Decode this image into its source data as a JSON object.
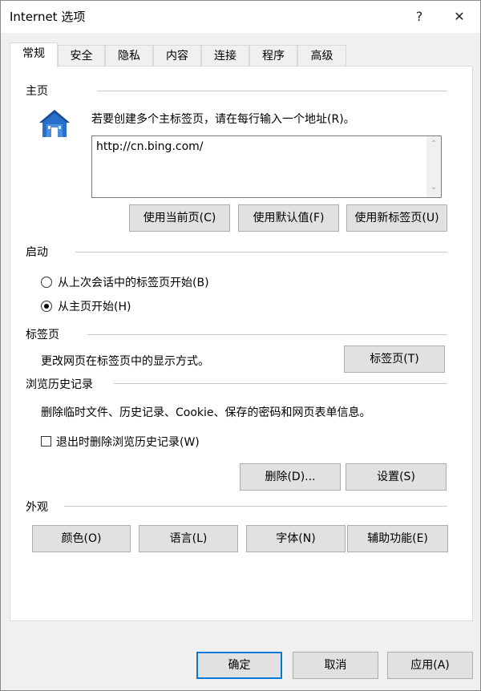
{
  "window": {
    "title": "Internet 选项",
    "help_label": "?",
    "close_label": "✕"
  },
  "tabs": [
    {
      "label": "常规",
      "active": true
    },
    {
      "label": "安全"
    },
    {
      "label": "隐私"
    },
    {
      "label": "内容"
    },
    {
      "label": "连接"
    },
    {
      "label": "程序"
    },
    {
      "label": "高级"
    }
  ],
  "homepage": {
    "group_label": "主页",
    "icon": "house-icon",
    "instruction": "若要创建多个主标签页，请在每行输入一个地址(R)。",
    "address_value": "http://cn.bing.com/",
    "use_current_label": "使用当前页(C)",
    "use_default_label": "使用默认值(F)",
    "use_new_tab_label": "使用新标签页(U)"
  },
  "startup": {
    "group_label": "启动",
    "option_last_session": "从上次会话中的标签页开始(B)",
    "option_home": "从主页开始(H)",
    "selected": "home"
  },
  "tabs_section": {
    "group_label": "标签页",
    "description": "更改网页在标签页中的显示方式。",
    "button_label": "标签页(T)"
  },
  "history": {
    "group_label": "浏览历史记录",
    "description": "删除临时文件、历史记录、Cookie、保存的密码和网页表单信息。",
    "delete_on_exit_label": "退出时删除浏览历史记录(W)",
    "delete_on_exit_checked": false,
    "delete_label": "删除(D)...",
    "settings_label": "设置(S)"
  },
  "appearance": {
    "group_label": "外观",
    "colors_label": "颜色(O)",
    "languages_label": "语言(L)",
    "fonts_label": "字体(N)",
    "accessibility_label": "辅助功能(E)"
  },
  "footer": {
    "ok_label": "确定",
    "cancel_label": "取消",
    "apply_label": "应用(A)"
  },
  "colors": {
    "accent": "#0078d7",
    "house_blue": "#2a6fc9"
  }
}
